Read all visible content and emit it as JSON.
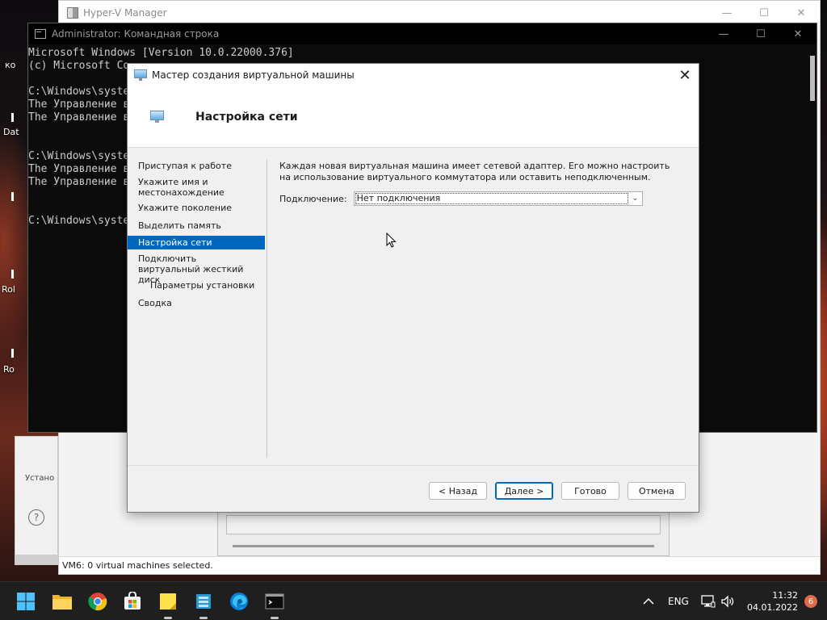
{
  "desktop": {
    "labels": [
      "ко",
      "Dat",
      "Rol",
      "Ro"
    ]
  },
  "hyperv": {
    "title": "Hyper-V Manager",
    "status": "VM6:  0 virtual machines selected.",
    "partial_label": "Устано",
    "help_partial": "У"
  },
  "cmd": {
    "title": "Administrator: Командная строка",
    "lines": [
      "Microsoft Windows [Version 10.0.22000.376]",
      "(c) Microsoft Co",
      "",
      "C:\\Windows\\syste",
      "The Управление в",
      "The Управление в",
      "",
      "",
      "C:\\Windows\\syste",
      "The Управление в",
      "The Управление в",
      "",
      "",
      "C:\\Windows\\syste"
    ]
  },
  "wizard": {
    "title": "Мастер создания виртуальной машины",
    "heading": "Настройка сети",
    "nav": [
      {
        "label": "Приступая к работе"
      },
      {
        "label": "Укажите имя и местонахождение"
      },
      {
        "label": "Укажите поколение"
      },
      {
        "label": "Выделить память"
      },
      {
        "label": "Настройка сети"
      },
      {
        "label": "Подключить виртуальный жесткий диск"
      },
      {
        "label": "Параметры установки"
      },
      {
        "label": "Сводка"
      }
    ],
    "selected_nav": "Настройка сети",
    "description": "Каждая новая виртуальная машина имеет сетевой адаптер. Его можно настроить на использование виртуального коммутатора или оставить неподключенным.",
    "connection_label": "Подключение:",
    "connection_value": "Нет подключения",
    "buttons": {
      "back": "< Назад",
      "next": "Далее >",
      "finish": "Готово",
      "cancel": "Отмена"
    }
  },
  "taskbar": {
    "language": "ENG",
    "time": "11:32",
    "date": "04.01.2022",
    "notifications": "6"
  },
  "colors": {
    "accent": "#0067c0",
    "taskbar": "#1f1f1f",
    "badge": "#e06a4a"
  }
}
